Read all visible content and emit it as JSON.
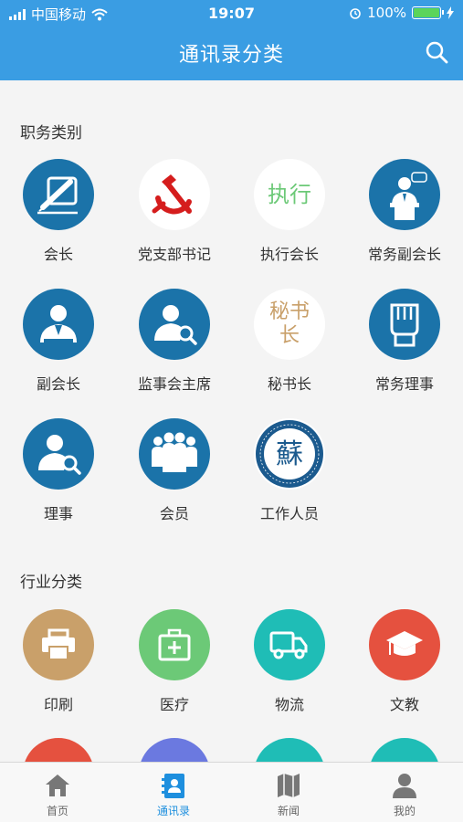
{
  "status_bar": {
    "carrier": "中国移动",
    "time": "19:07",
    "battery": "100%"
  },
  "nav": {
    "title": "通讯录分类",
    "search_icon": "search-icon"
  },
  "sections": [
    {
      "title": "职务类别"
    },
    {
      "title": "行业分类"
    }
  ],
  "positions": [
    {
      "label": "会长",
      "icon": "pen-signature-icon"
    },
    {
      "label": "党支部书记",
      "icon": "hammer-sickle-icon"
    },
    {
      "label": "执行会长",
      "icon_text": "执行"
    },
    {
      "label": "常务副会长",
      "icon": "speaker-podium-icon"
    },
    {
      "label": "副会长",
      "icon": "person-suit-icon"
    },
    {
      "label": "监事会主席",
      "icon": "person-magnifier-icon"
    },
    {
      "label": "秘书长",
      "icon_text": "秘书长"
    },
    {
      "label": "常务理事",
      "icon": "raised-fist-icon"
    },
    {
      "label": "理事",
      "icon": "person-magnifier-icon"
    },
    {
      "label": "会员",
      "icon": "group-people-icon"
    },
    {
      "label": "工作人员",
      "icon": "chamber-seal-icon",
      "seal_char": "蘇"
    }
  ],
  "industries": [
    {
      "label": "印刷",
      "icon": "printer-icon",
      "color": "#c9a06a"
    },
    {
      "label": "医疗",
      "icon": "medical-kit-icon",
      "color": "#6cc977"
    },
    {
      "label": "物流",
      "icon": "truck-icon",
      "color": "#1fbdb6"
    },
    {
      "label": "文教",
      "icon": "graduation-cap-icon",
      "color": "#e5513f"
    }
  ],
  "more_industry_colors": [
    "#e5513f",
    "#6b79e0",
    "#1fbdb6",
    "#1fbdb6"
  ],
  "tabs": [
    {
      "label": "首页",
      "icon": "home-icon",
      "active": false
    },
    {
      "label": "通讯录",
      "icon": "contacts-book-icon",
      "active": true
    },
    {
      "label": "新闻",
      "icon": "news-map-icon",
      "active": false
    },
    {
      "label": "我的",
      "icon": "user-icon",
      "active": false
    }
  ]
}
